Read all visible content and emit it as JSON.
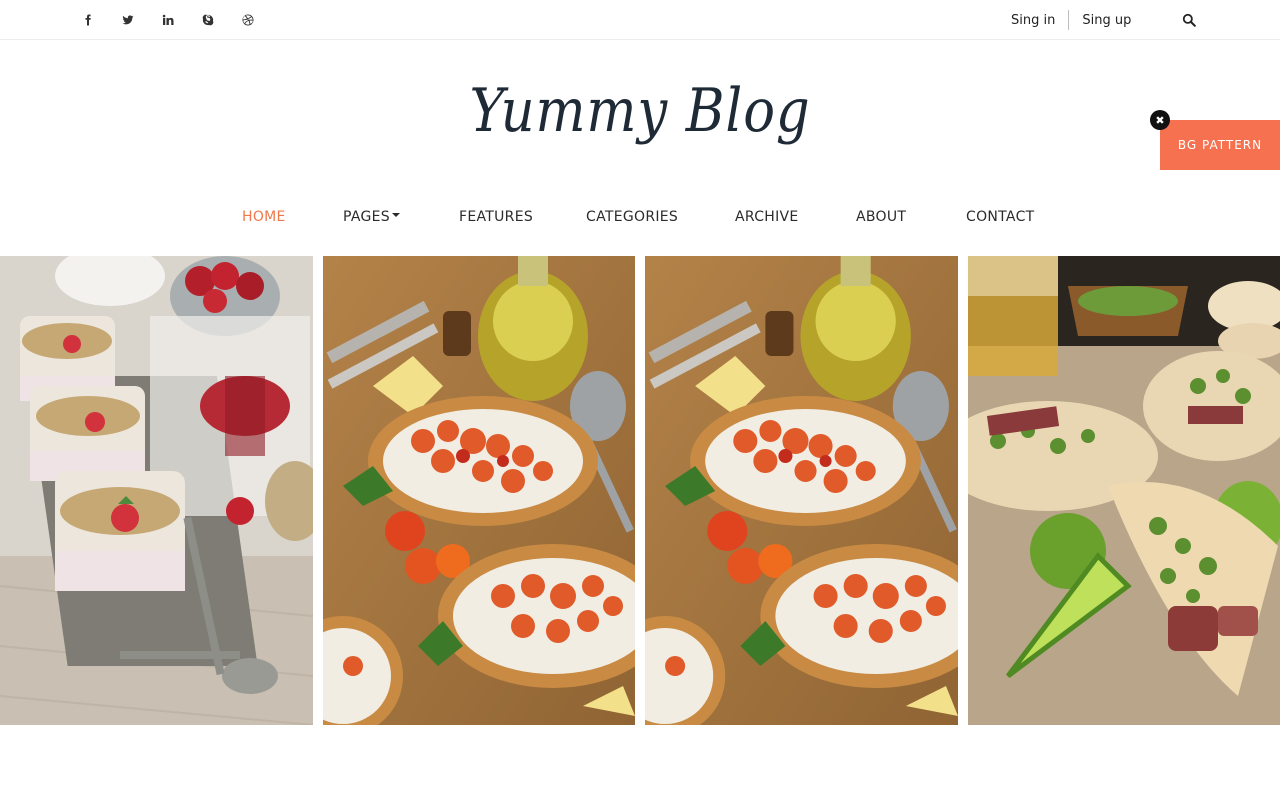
{
  "topbar": {
    "social_icons": [
      "facebook-icon",
      "twitter-icon",
      "linkedin-icon",
      "skype-icon",
      "dribbble-icon"
    ],
    "sign_in": "Sing in",
    "sign_up": "Sing up",
    "search_icon": "search-icon"
  },
  "logo": {
    "text": "Yummy Blog"
  },
  "bg_pattern": {
    "label": "BG PATTERN",
    "close_icon": "close-icon",
    "color": "#f5714f"
  },
  "nav": {
    "items": [
      {
        "label": "HOME",
        "active": true
      },
      {
        "label": "PAGES",
        "dropdown": true
      },
      {
        "label": "FEATURES"
      },
      {
        "label": "CATEGORIES"
      },
      {
        "label": "ARCHIVE"
      },
      {
        "label": "ABOUT"
      },
      {
        "label": "CONTACT"
      }
    ],
    "active_color": "#f0784b"
  },
  "gallery": {
    "images": [
      {
        "subject": "overnight oats with strawberries"
      },
      {
        "subject": "bruschetta with tomatoes"
      },
      {
        "subject": "bruschetta with tomatoes"
      },
      {
        "subject": "tacos with lime"
      }
    ]
  }
}
